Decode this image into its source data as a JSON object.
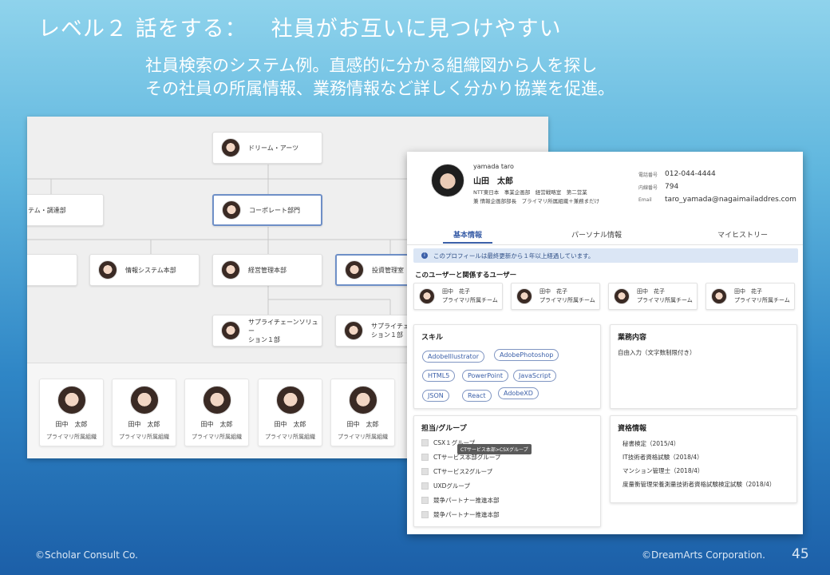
{
  "slide": {
    "title_level": "レベル２ 話をする：",
    "title_main": "社員がお互いに見つけやすい",
    "subtitle_line1": "社員検索のシステム例。直感的に分かる組織図から人を探し",
    "subtitle_line2": "その社員の所属情報、業務情報など詳しく分かり協業を促進。",
    "footer_left": "©Scholar Consult Co.",
    "footer_right": "©DreamArts Corporation.",
    "page_number": "45"
  },
  "org_chart": {
    "nodes": {
      "dream_arts": "ドリーム・アーツ",
      "systems_procurement": "ステム・調達部",
      "corporate": "コーポレート部門",
      "info_systems": "情報システム本部",
      "management_planning": "経営管理本部",
      "investment": "投資管理室",
      "supply_chain_1": "サプライチェーンソリュー",
      "supply_chain_1b": "ション１部",
      "supply_chain_2": "サプライチェ",
      "supply_chain_2b": "ション１部"
    },
    "people": [
      {
        "name": "田中　太郎",
        "org": "プライマリ所属組織"
      },
      {
        "name": "田中　太郎",
        "org": "プライマリ所属組織"
      },
      {
        "name": "田中　太郎",
        "org": "プライマリ所属組織"
      },
      {
        "name": "田中　太郎",
        "org": "プライマリ所属組織"
      },
      {
        "name": "田中　太郎",
        "org": "プライマリ所属組織"
      }
    ]
  },
  "profile": {
    "name_roman": "yamada taro",
    "name": "山田　太郎",
    "dept_line1": "NTT東日本　事業企画部　経営戦略室　第二営業",
    "dept_line2": "兼 情報企画部部長　プライマリ所属組織＋兼務まだけ",
    "contact": {
      "phone_label": "電話番号",
      "phone": "012-044-4444",
      "ext_label": "内線番号",
      "ext": "794",
      "email_label": "Email",
      "email": "taro_yamada@nagaimailaddres.com"
    },
    "tabs": [
      "基本情報",
      "パーソナル情報",
      "マイヒストリー"
    ],
    "notice": "このプロフィールは最終更新から１年以上経過しています。",
    "related_title": "このユーザーと関係するユーザー",
    "related_users": [
      {
        "name": "田中　花子",
        "team": "プライマリ所属チーム"
      },
      {
        "name": "田中　花子",
        "team": "プライマリ所属チーム"
      },
      {
        "name": "田中　花子",
        "team": "プライマリ所属チーム"
      },
      {
        "name": "田中　花子",
        "team": "プライマリ所属チーム"
      }
    ],
    "skills_title": "スキル",
    "skills": [
      "AdobeIllustrator",
      "AdobePhotoshop",
      "HTML5",
      "PowerPoint",
      "JavaScript",
      "JSON",
      "React",
      "AdobeXD"
    ],
    "work_title": "業務内容",
    "work_text": "自由入力（文字数制限付き）",
    "groups_title": "担当/グループ",
    "groups": [
      "CSX１グループ",
      "CTサービス本部グループ",
      "CTサービス2グループ",
      "UXDグループ",
      "競争パートナー推進本部",
      "競争パートナー推進本部"
    ],
    "tooltip": "CTサービス本部>CSXグループ",
    "quals_title": "資格情報",
    "quals": [
      "秘書検定（2015/4）",
      "IT技術者資格試験（2018/4）",
      "マンション管理士（2018/4）",
      "度量衡管理栄養測量技術者資格試験検定試験（2018/4）"
    ]
  }
}
